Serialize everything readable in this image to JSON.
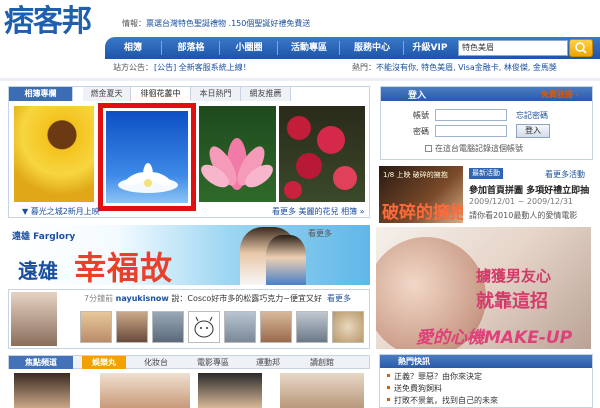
{
  "header": {
    "logo_text": "痞客",
    "logo_bang": "邦",
    "news_label": "情報：",
    "news_link": "票選台灣特色聖誕禮物 .150個聖誕好禮免費送",
    "search_value": "特色美眉",
    "nav": [
      "相簿",
      "部落格",
      "小圈圈",
      "活動專區",
      "服務中心",
      "升級VIP"
    ]
  },
  "subbar": {
    "announce_label": "站方公告：",
    "announce_link": "[公告] 全新客服系統上線！",
    "hot_label": "熱門：",
    "hot_links": "不能沒有你, 特色美眉, Visa金融卡, 林俊傑, 金馬獎"
  },
  "album": {
    "tabs": [
      "相簿專欄",
      "燃金夏天",
      "徘徊花叢中",
      "本日熱門",
      "網友推薦"
    ],
    "caption_left": "▼ 暮光之城2新月上映",
    "caption_right": "看更多 美麗的花兒 相簿 »"
  },
  "banner": {
    "brand": "遠雄 Farglory",
    "city": "遠雄",
    "slogan": "幸福故",
    "tag": "看更多"
  },
  "user_feed": {
    "time": "7分鐘前",
    "user": "nayukisnow",
    "said": "說：",
    "text": "Cosco好市多的松露巧克力~便宜又好",
    "more": "看更多"
  },
  "bottom_tabs": [
    "焦點頻道",
    "娛樂丸",
    "化妝台",
    "電影專區",
    "運動邦",
    "讀創館"
  ],
  "login": {
    "title": "登入",
    "free_apply": "免費註冊 ›",
    "account_label": "帳號",
    "password_label": "密碼",
    "forgot": "忘記密碼",
    "button": "登入",
    "remember": "在這台電腦記錄這個帳號"
  },
  "event": {
    "badge": "最新活動",
    "more": "看更多活動",
    "title": "參加首頁拼圖 多項好禮立即抽",
    "date": "2009/12/01 ~ 2009/12/31",
    "desc": "請你看2010最動人的愛情電影",
    "image_small": "1/8 上映 破碎的擁抱",
    "image_big": "破碎的擁抱"
  },
  "ad": {
    "line1": "擄獲男友心",
    "line2": "就靠這招",
    "line3": "愛的心機MAKE-UP"
  },
  "hot_news": {
    "title": "熱門快訊",
    "items": [
      "正義？罪惡？由你來決定",
      "送免費狗飼料",
      "打敗不景氣，找到自己的未來"
    ]
  }
}
